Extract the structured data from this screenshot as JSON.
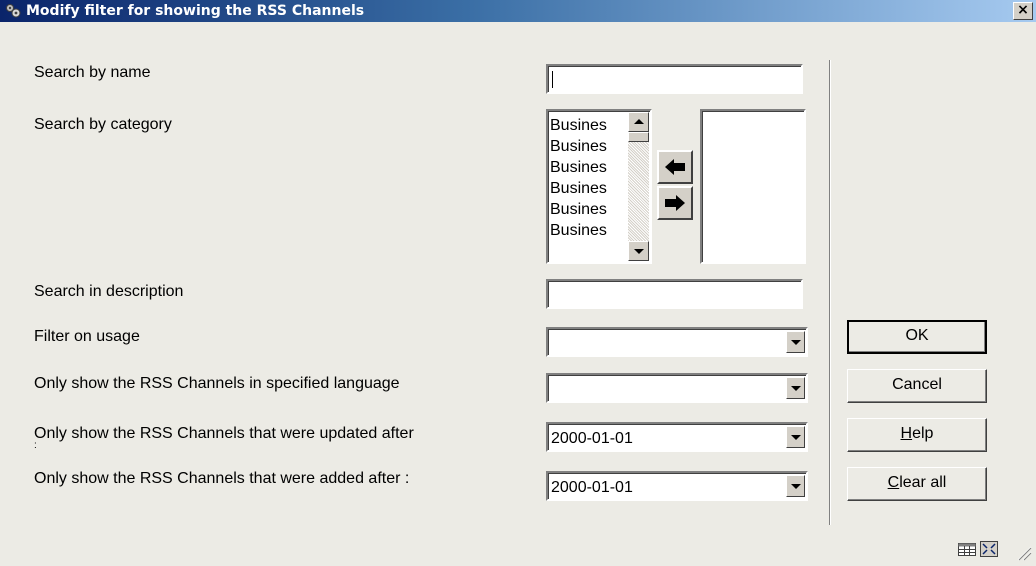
{
  "window": {
    "title": "Modify filter for showing the RSS Channels",
    "close_glyph": "×"
  },
  "form": {
    "search_by_name": {
      "label": "Search by name",
      "value": ""
    },
    "search_by_category": {
      "label": "Search by category",
      "available": [
        "Busines",
        "Busines",
        "Busines",
        "Busines",
        "Busines",
        "Busines"
      ],
      "selected": []
    },
    "search_in_description": {
      "label": "Search in description",
      "value": ""
    },
    "filter_on_usage": {
      "label": "Filter on usage",
      "value": ""
    },
    "language": {
      "label": "Only show the RSS Channels in specified language",
      "value": ""
    },
    "updated_after": {
      "label": "Only show the RSS Channels that were updated after",
      "label_overflow": ":",
      "value": "2000-01-01"
    },
    "added_after": {
      "label": "Only show the RSS Channels that were added after :",
      "value": "2000-01-01"
    }
  },
  "buttons": {
    "ok": "OK",
    "cancel": "Cancel",
    "help_mnemonic": "H",
    "help_rest": "elp",
    "clear_mnemonic": "C",
    "clear_rest": "lear all"
  },
  "icons": {
    "title": "app-icon",
    "move_left": "arrow-left-icon",
    "move_right": "arrow-right-icon",
    "status_grid": "grid-icon",
    "status_max": "maximize-icon",
    "grip": "resize-grip-icon"
  }
}
